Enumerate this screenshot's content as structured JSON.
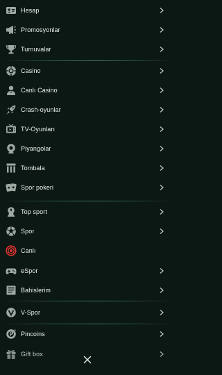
{
  "colors": {
    "background": "#0b1814",
    "text": "#ecf1ee",
    "icon": "#9fa9a4",
    "divider": "#3f7a5a",
    "live_red": "#e0342f"
  },
  "menu": {
    "items": [
      {
        "label": "Hesap",
        "icon": "id-card-icon"
      },
      {
        "label": "Promosyonlar",
        "icon": "megaphone-icon"
      },
      {
        "label": "Turnuvalar",
        "icon": "trophy-icon"
      },
      {
        "label": "Casino",
        "icon": "casino-chip-icon"
      },
      {
        "label": "Canlı Casino",
        "icon": "dealer-icon"
      },
      {
        "label": "Crash-oyunlar",
        "icon": "rocket-icon"
      },
      {
        "label": "TV-Oyunları",
        "icon": "tv-icon"
      },
      {
        "label": "Piyangolar",
        "icon": "lottery-ball-icon"
      },
      {
        "label": "Tombala",
        "icon": "bingo-icon"
      },
      {
        "label": "Spor pokeri",
        "icon": "cards-icon"
      },
      {
        "label": "Top sport",
        "icon": "top-sport-icon"
      },
      {
        "label": "Spor",
        "icon": "soccer-ball-icon"
      },
      {
        "label": "Canlı",
        "icon": "live-icon"
      },
      {
        "label": "eSpor",
        "icon": "gamepad-icon"
      },
      {
        "label": "Bahislerim",
        "icon": "bet-slip-icon"
      },
      {
        "label": "V-Spor",
        "icon": "virtual-sport-icon"
      },
      {
        "label": "Pincoins",
        "icon": "pincoin-icon"
      },
      {
        "label": "Gift box",
        "icon": "gift-box-icon"
      }
    ]
  }
}
